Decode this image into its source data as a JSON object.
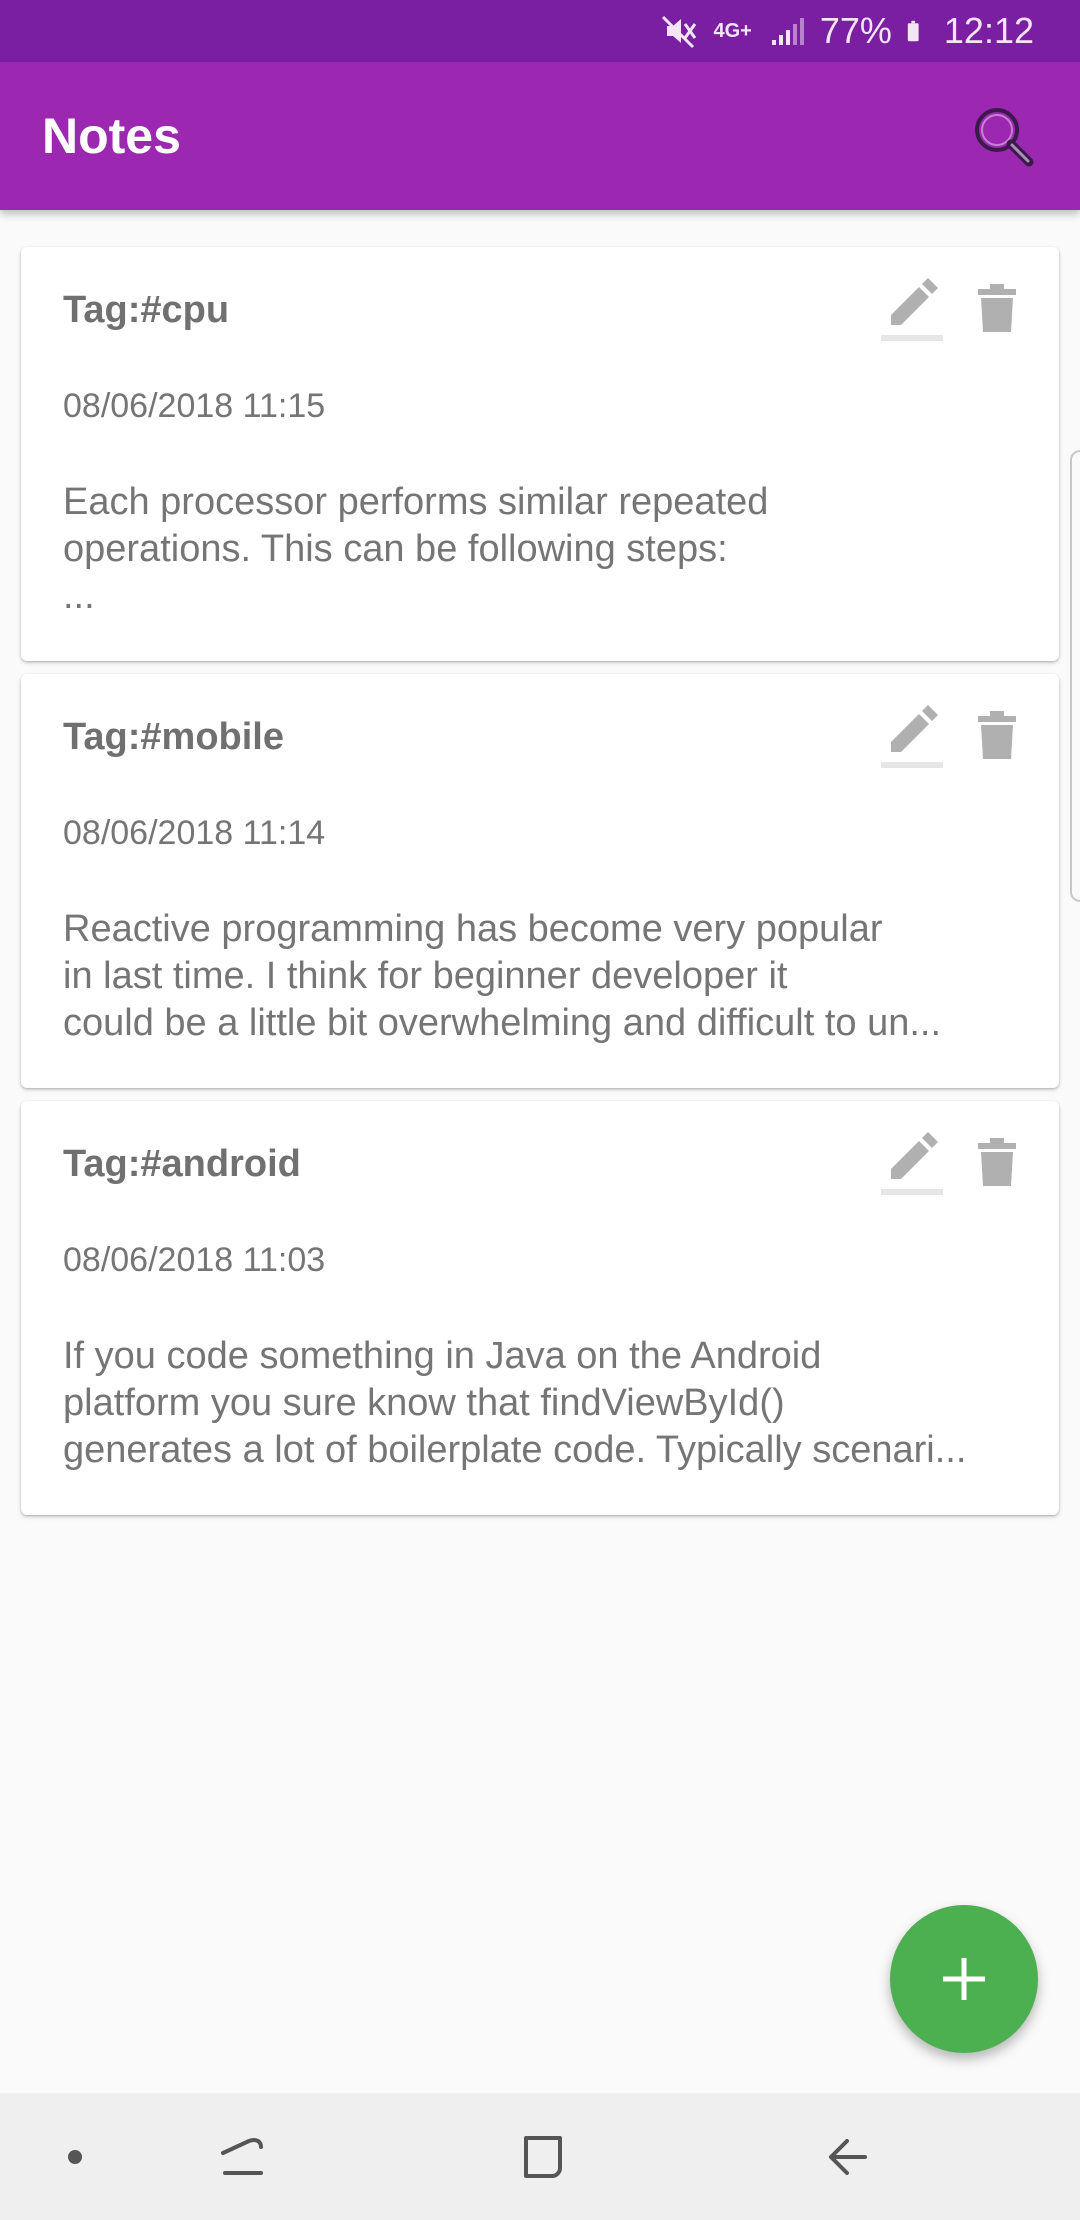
{
  "status_bar": {
    "network": "4G+",
    "battery": "77%",
    "time": "12:12"
  },
  "app_bar": {
    "title": "Notes",
    "search_icon": "search-icon"
  },
  "notes": [
    {
      "tag": "Tag:#cpu",
      "date": "08/06/2018 11:15",
      "text": "Each processor performs similar repeated\noperations. This can be following steps:\n..."
    },
    {
      "tag": "Tag:#mobile",
      "date": "08/06/2018 11:14",
      "text": "Reactive programming has become very popular\nin last time. I think for beginner developer it\ncould be a little bit overwhelming and difficult to un..."
    },
    {
      "tag": "Tag:#android",
      "date": "08/06/2018 11:03",
      "text": "If you code something in Java on the Android\nplatform you sure know that findViewById()\ngenerates a lot of boilerplate code. Typically scenari..."
    }
  ],
  "fab": {
    "icon": "plus-icon",
    "color": "#4caf50"
  },
  "colors": {
    "primary": "#9c27b0",
    "primary_dark": "#7b1fa2",
    "card_text": "#757575",
    "icon_gray": "#b0b0b0"
  }
}
